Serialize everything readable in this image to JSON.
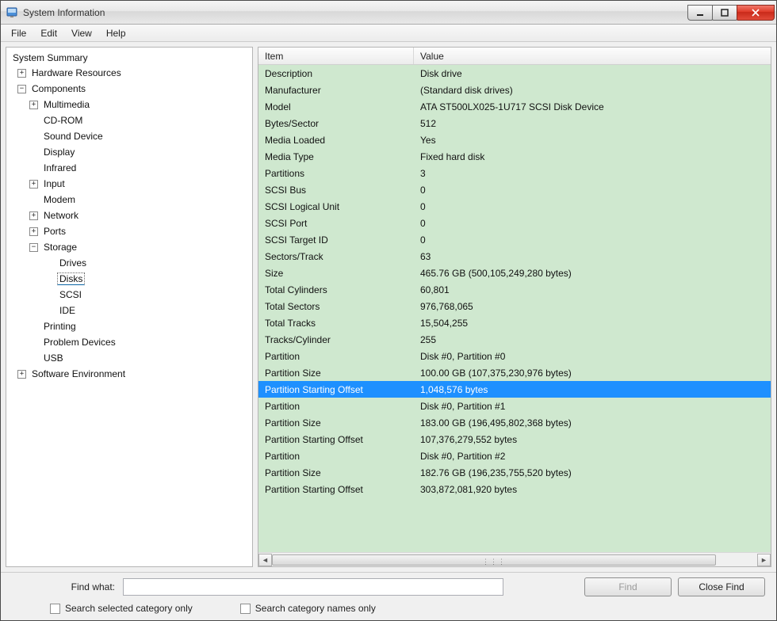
{
  "window": {
    "title": "System Information"
  },
  "menubar": {
    "items": [
      "File",
      "Edit",
      "View",
      "Help"
    ]
  },
  "tree": {
    "root": "System Summary",
    "hardware_resources": "Hardware Resources",
    "components": {
      "label": "Components",
      "multimedia": "Multimedia",
      "cdrom": "CD-ROM",
      "sound": "Sound Device",
      "display": "Display",
      "infrared": "Infrared",
      "input": "Input",
      "modem": "Modem",
      "network": "Network",
      "ports": "Ports",
      "storage": {
        "label": "Storage",
        "drives": "Drives",
        "disks": "Disks",
        "scsi": "SCSI",
        "ide": "IDE"
      },
      "printing": "Printing",
      "problem": "Problem Devices",
      "usb": "USB"
    },
    "software_env": "Software Environment"
  },
  "detail": {
    "headers": {
      "item": "Item",
      "value": "Value"
    },
    "rows": [
      {
        "item": "Description",
        "value": "Disk drive"
      },
      {
        "item": "Manufacturer",
        "value": "(Standard disk drives)"
      },
      {
        "item": "Model",
        "value": "ATA ST500LX025-1U717 SCSI Disk Device"
      },
      {
        "item": "Bytes/Sector",
        "value": "512"
      },
      {
        "item": "Media Loaded",
        "value": "Yes"
      },
      {
        "item": "Media Type",
        "value": "Fixed hard disk"
      },
      {
        "item": "Partitions",
        "value": "3"
      },
      {
        "item": "SCSI Bus",
        "value": "0"
      },
      {
        "item": "SCSI Logical Unit",
        "value": "0"
      },
      {
        "item": "SCSI Port",
        "value": "0"
      },
      {
        "item": "SCSI Target ID",
        "value": "0"
      },
      {
        "item": "Sectors/Track",
        "value": "63"
      },
      {
        "item": "Size",
        "value": "465.76 GB (500,105,249,280 bytes)"
      },
      {
        "item": "Total Cylinders",
        "value": "60,801"
      },
      {
        "item": "Total Sectors",
        "value": "976,768,065"
      },
      {
        "item": "Total Tracks",
        "value": "15,504,255"
      },
      {
        "item": "Tracks/Cylinder",
        "value": "255"
      },
      {
        "item": "Partition",
        "value": "Disk #0, Partition #0"
      },
      {
        "item": "Partition Size",
        "value": "100.00 GB (107,375,230,976 bytes)"
      },
      {
        "item": "Partition Starting Offset",
        "value": "1,048,576 bytes",
        "selected": true
      },
      {
        "item": "Partition",
        "value": "Disk #0, Partition #1"
      },
      {
        "item": "Partition Size",
        "value": "183.00 GB (196,495,802,368 bytes)"
      },
      {
        "item": "Partition Starting Offset",
        "value": "107,376,279,552 bytes"
      },
      {
        "item": "Partition",
        "value": "Disk #0, Partition #2"
      },
      {
        "item": "Partition Size",
        "value": "182.76 GB (196,235,755,520 bytes)"
      },
      {
        "item": "Partition Starting Offset",
        "value": "303,872,081,920 bytes"
      }
    ]
  },
  "footer": {
    "find_label": "Find what:",
    "find_value": "",
    "find_btn": "Find",
    "close_btn": "Close Find",
    "check1": "Search selected category only",
    "check2": "Search category names only"
  }
}
